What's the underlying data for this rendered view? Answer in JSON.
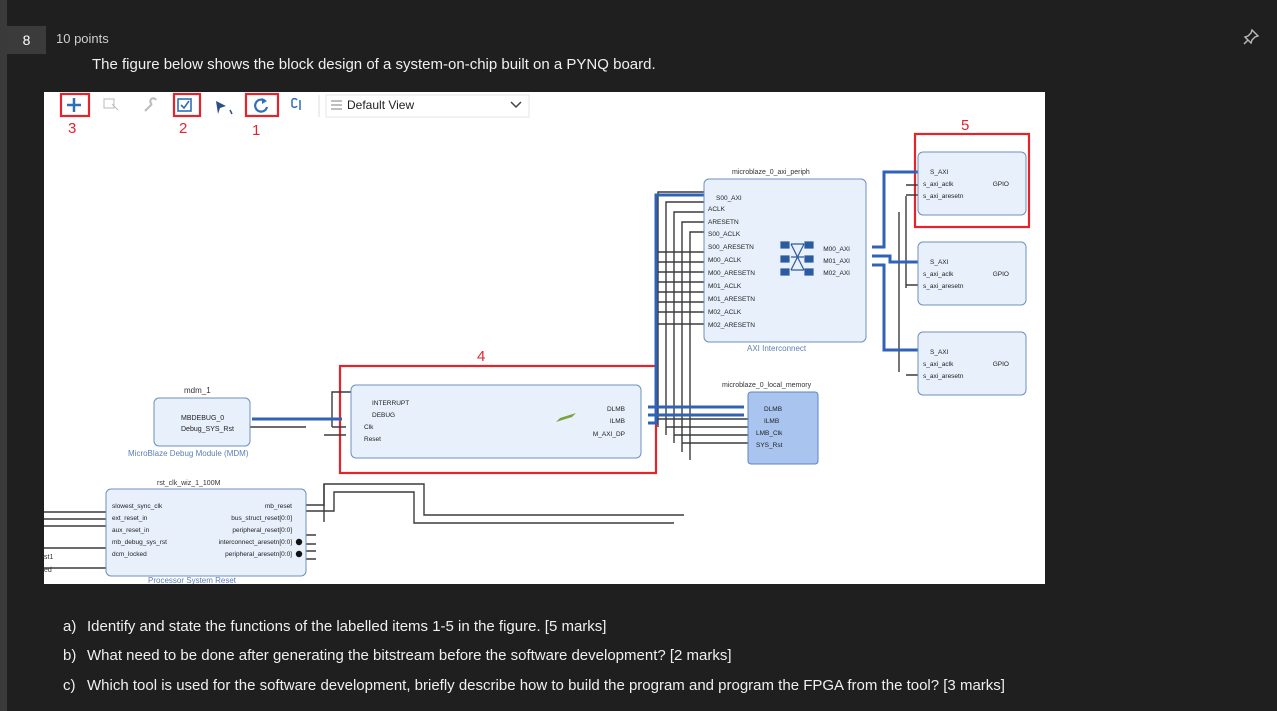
{
  "question": {
    "number": "8",
    "points": "10 points",
    "intro": "The figure below shows the block design of a system-on-chip built on a PYNQ board.",
    "parts": [
      {
        "label": "a)",
        "text": "Identify and state the functions of the labelled items 1-5 in the figure.  [5 marks]"
      },
      {
        "label": "b)",
        "text": "What need to be done after generating the bitstream before the software development? [2 marks]"
      },
      {
        "label": "c)",
        "text": "Which tool is used for the software development, briefly describe how to build the program and program the FPGA from the tool? [3 marks]"
      }
    ]
  },
  "figure": {
    "toolbar": {
      "view_select": "Default View"
    },
    "callouts": [
      "1",
      "2",
      "3",
      "4",
      "5"
    ],
    "blocks": {
      "mdm": {
        "name": "mdm_1",
        "caption": "MicroBlaze Debug Module (MDM)",
        "ports": [
          "MBDEBUG_0",
          "Debug_SYS_Rst"
        ]
      },
      "rst": {
        "name": "rst_clk_wiz_1_100M",
        "caption": "Processor System Reset",
        "left_ports": [
          "slowest_sync_clk",
          "ext_reset_in",
          "aux_reset_in",
          "mb_debug_sys_rst",
          "dcm_locked"
        ],
        "right_ports": [
          "mb_reset",
          "bus_struct_reset[0:0]",
          "peripheral_reset[0:0]",
          "interconnect_aresetn[0:0]",
          "peripheral_aresetn[0:0]"
        ]
      },
      "microblaze": {
        "left_ports": [
          "INTERRUPT",
          "DEBUG",
          "Clk",
          "Reset"
        ],
        "right_ports": [
          "DLMB",
          "ILMB",
          "M_AXI_DP"
        ]
      },
      "interconnect": {
        "name": "microblaze_0_axi_periph",
        "caption": "AXI Interconnect",
        "left_ports": [
          "S00_AXI",
          "ACLK",
          "ARESETN",
          "S00_ACLK",
          "S00_ARESETN",
          "M00_ACLK",
          "M00_ARESETN",
          "M01_ACLK",
          "M01_ARESETN",
          "M02_ACLK",
          "M02_ARESETN"
        ],
        "right_ports": [
          "M00_AXI",
          "M01_AXI",
          "M02_AXI"
        ]
      },
      "local_memory": {
        "name": "microblaze_0_local_memory",
        "ports": [
          "DLMB",
          "ILMB",
          "LMB_Clk",
          "SYS_Rst"
        ]
      },
      "gpio": {
        "ports": [
          "S_AXI",
          "s_axi_aclk",
          "s_axi_aresetn"
        ],
        "out": "GPIO"
      }
    },
    "edge_fragments": [
      "st1",
      "ed"
    ]
  }
}
